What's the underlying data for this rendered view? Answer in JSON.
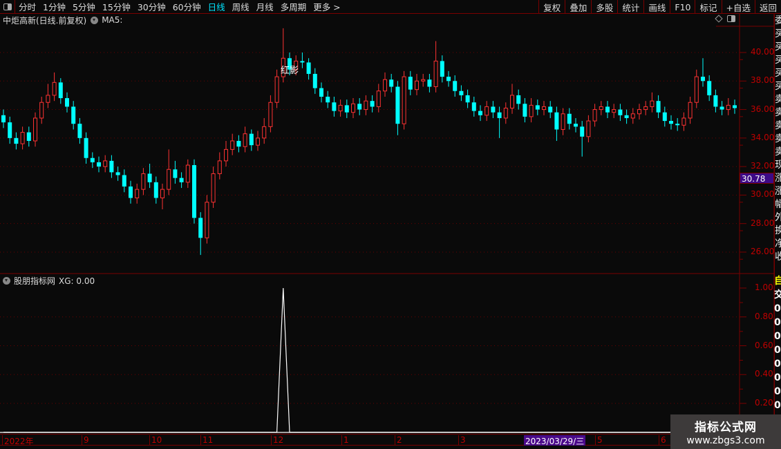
{
  "toolbar": {
    "periods": [
      {
        "label": "分时",
        "active": false
      },
      {
        "label": "1分钟",
        "active": false
      },
      {
        "label": "5分钟",
        "active": false
      },
      {
        "label": "15分钟",
        "active": false
      },
      {
        "label": "30分钟",
        "active": false
      },
      {
        "label": "60分钟",
        "active": false
      },
      {
        "label": "日线",
        "active": true
      },
      {
        "label": "周线",
        "active": false
      },
      {
        "label": "月线",
        "active": false
      },
      {
        "label": "多周期",
        "active": false
      },
      {
        "label": "更多 >",
        "active": false
      }
    ],
    "right_buttons": [
      "复权",
      "叠加",
      "多股",
      "统计",
      "画线",
      "F10",
      "标记",
      "+自选",
      "返回"
    ]
  },
  "main_chart": {
    "title": "中炬高新(日线.前复权)",
    "indicator": "MA5:",
    "annotation": "红影",
    "current_price_tag": "30.78",
    "price_labels": [
      "40.00",
      "38.00",
      "36.00",
      "34.00",
      "32.00",
      "30.00",
      "28.00",
      "26.00"
    ]
  },
  "sub_chart": {
    "title": "股朋指标网",
    "indicator": "XG: 0.00",
    "labels": [
      "1.00",
      "0.80",
      "0.60",
      "0.40",
      "0.20"
    ]
  },
  "time_axis": {
    "labels": [
      "2022年",
      "9",
      "10",
      "11",
      "12",
      "1",
      "2",
      "3",
      "2023/03/29/三",
      "5",
      "6"
    ],
    "highlighted": "2023/03/29/三"
  },
  "side_panel": {
    "chars": [
      "委",
      "买",
      "买",
      "买",
      "买",
      "买",
      "卖",
      "卖",
      "卖",
      "卖",
      "卖",
      "现",
      "涨",
      "涨",
      "幅",
      "外",
      "换",
      "净",
      "收"
    ],
    "sub_chars": [
      "自",
      "交",
      "0",
      "0",
      "0",
      "0",
      "0",
      "0",
      "0",
      "0",
      "0"
    ]
  },
  "watermark": {
    "title": "指标公式网",
    "url": "www.zbgs3.com"
  },
  "colors": {
    "up": "#ff3232",
    "down": "#00ffff",
    "axis": "#c00000",
    "grid": "#7a0000",
    "highlight": "#4b0a8a"
  },
  "chart_data": {
    "type": "candlestick",
    "ylim": [
      25.5,
      42
    ],
    "open": [
      35.6,
      35.1,
      34.0,
      33.6,
      34.4,
      33.8,
      35.4,
      36.5,
      37.0,
      37.9,
      36.8,
      36.2,
      35.0,
      34.0,
      32.6,
      32.3,
      32.0,
      32.4,
      31.6,
      31.4,
      30.6,
      29.8,
      30.4,
      31.5,
      30.9,
      29.8,
      30.4,
      31.8,
      31.2,
      30.9,
      32.1,
      28.4,
      27.0,
      29.5,
      31.5,
      32.4,
      33.2,
      33.8,
      33.4,
      34.3,
      33.5,
      34.0,
      34.8,
      36.5,
      38.3,
      39.6,
      38.8,
      39.4,
      39.3,
      38.5,
      37.5,
      36.9,
      36.5,
      35.9,
      36.3,
      35.8,
      36.4,
      36.0,
      36.6,
      36.2,
      37.3,
      38.1,
      37.6,
      35.0,
      38.3,
      37.4,
      38.0,
      38.1,
      37.6,
      39.4,
      38.3,
      38.0,
      37.3,
      37.0,
      36.5,
      35.9,
      35.6,
      36.2,
      35.8,
      35.4,
      36.1,
      37.0,
      36.4,
      35.5,
      36.3,
      36.0,
      36.2,
      35.8,
      34.6,
      35.7,
      35.0,
      34.8,
      34.1,
      35.2,
      36.0,
      36.2,
      35.8,
      36.0,
      35.6,
      35.4,
      35.7,
      36.0,
      36.2,
      36.6,
      35.8,
      35.2,
      35.0,
      34.9,
      35.4,
      36.5,
      38.3,
      38.0,
      37.0,
      36.2,
      36.0,
      36.3
    ],
    "high": [
      36.0,
      35.5,
      34.4,
      34.8,
      34.8,
      35.8,
      36.9,
      37.8,
      38.6,
      38.2,
      37.2,
      36.6,
      35.4,
      34.4,
      33.0,
      32.7,
      32.8,
      32.8,
      32.0,
      31.8,
      31.0,
      30.8,
      31.9,
      32.2,
      31.3,
      30.8,
      33.2,
      32.4,
      31.6,
      32.5,
      32.5,
      28.8,
      30.0,
      32.0,
      33.0,
      33.8,
      34.3,
      34.2,
      34.8,
      34.6,
      34.5,
      35.4,
      37.0,
      38.8,
      41.7,
      40.0,
      39.8,
      40.0,
      39.6,
      38.9,
      37.9,
      37.3,
      36.9,
      36.7,
      36.7,
      36.8,
      36.8,
      37.0,
      37.0,
      37.8,
      38.6,
      38.5,
      38.0,
      38.7,
      38.7,
      38.5,
      38.5,
      38.5,
      40.8,
      39.8,
      38.7,
      38.4,
      37.7,
      37.4,
      36.9,
      36.3,
      36.6,
      36.6,
      36.2,
      36.5,
      37.8,
      37.4,
      36.8,
      36.8,
      36.7,
      36.6,
      36.6,
      36.2,
      36.1,
      36.1,
      35.4,
      35.2,
      35.6,
      36.4,
      36.6,
      36.6,
      36.4,
      36.4,
      36.0,
      36.1,
      36.4,
      36.6,
      37.2,
      37.0,
      36.2,
      35.6,
      35.4,
      35.8,
      36.9,
      38.8,
      39.6,
      38.4,
      37.4,
      36.6,
      36.8,
      36.7
    ],
    "low": [
      34.7,
      33.6,
      33.2,
      33.2,
      33.4,
      33.4,
      35.0,
      36.1,
      36.6,
      36.4,
      35.8,
      34.6,
      33.6,
      32.2,
      31.9,
      31.6,
      31.6,
      31.2,
      31.0,
      30.2,
      29.4,
      29.4,
      30.0,
      30.5,
      29.4,
      29.0,
      30.0,
      30.8,
      30.5,
      30.5,
      28.0,
      25.8,
      26.6,
      29.1,
      31.1,
      32.0,
      32.8,
      33.0,
      33.0,
      33.1,
      33.1,
      33.6,
      34.4,
      36.1,
      37.9,
      38.4,
      38.4,
      38.9,
      38.1,
      37.1,
      36.5,
      36.1,
      35.5,
      35.5,
      35.4,
      35.4,
      35.6,
      35.6,
      35.8,
      35.8,
      36.9,
      37.2,
      34.2,
      34.6,
      37.0,
      37.0,
      37.6,
      37.2,
      37.2,
      37.9,
      37.6,
      36.9,
      36.6,
      36.1,
      35.5,
      35.2,
      35.2,
      35.4,
      34.0,
      35.0,
      35.7,
      36.0,
      35.1,
      35.1,
      35.6,
      35.6,
      35.4,
      33.8,
      34.2,
      34.6,
      34.4,
      32.7,
      33.7,
      34.8,
      35.6,
      35.4,
      35.4,
      35.2,
      35.0,
      35.0,
      35.3,
      35.6,
      35.8,
      35.4,
      34.8,
      34.6,
      34.5,
      34.5,
      35.0,
      36.1,
      37.6,
      36.6,
      35.8,
      35.6,
      35.6,
      35.7
    ],
    "close": [
      35.1,
      34.0,
      33.6,
      34.4,
      33.8,
      35.4,
      36.5,
      37.0,
      37.9,
      36.8,
      36.2,
      35.0,
      34.0,
      32.6,
      32.3,
      32.0,
      32.4,
      31.6,
      31.4,
      30.6,
      29.8,
      30.4,
      31.5,
      30.9,
      29.8,
      30.4,
      31.8,
      31.2,
      30.9,
      32.1,
      28.4,
      27.0,
      29.5,
      31.5,
      32.4,
      33.2,
      33.8,
      33.4,
      34.3,
      33.5,
      34.0,
      34.8,
      36.5,
      38.3,
      39.6,
      38.8,
      39.4,
      39.3,
      38.5,
      37.5,
      36.9,
      36.5,
      35.9,
      36.3,
      35.8,
      36.4,
      36.0,
      36.6,
      36.2,
      37.3,
      38.1,
      37.6,
      35.0,
      38.3,
      37.4,
      38.0,
      38.1,
      37.6,
      39.4,
      38.3,
      38.0,
      37.3,
      37.0,
      36.5,
      35.9,
      35.6,
      36.2,
      35.8,
      35.4,
      36.1,
      37.0,
      36.4,
      35.5,
      36.3,
      36.0,
      36.2,
      35.8,
      34.6,
      35.7,
      35.0,
      34.8,
      34.1,
      35.2,
      36.0,
      36.2,
      35.8,
      36.0,
      35.6,
      35.4,
      35.7,
      36.0,
      36.2,
      36.6,
      35.8,
      35.2,
      35.0,
      34.9,
      35.4,
      36.5,
      38.3,
      38.0,
      37.0,
      36.2,
      36.0,
      36.3,
      36.1
    ],
    "xg": [
      0,
      0,
      0,
      0,
      0,
      0,
      0,
      0,
      0,
      0,
      0,
      0,
      0,
      0,
      0,
      0,
      0,
      0,
      0,
      0,
      0,
      0,
      0,
      0,
      0,
      0,
      0,
      0,
      0,
      0,
      0,
      0,
      0,
      0,
      0,
      0,
      0,
      0,
      0,
      0,
      0,
      0,
      0,
      0,
      1,
      0,
      0,
      0,
      0,
      0,
      0,
      0,
      0,
      0,
      0,
      0,
      0,
      0,
      0,
      0,
      0,
      0,
      0,
      0,
      0,
      0,
      0,
      0,
      0,
      0,
      0,
      0,
      0,
      0,
      0,
      0,
      0,
      0,
      0,
      0,
      0,
      0,
      0,
      0,
      0,
      0,
      0,
      0,
      0,
      0,
      0,
      0,
      0,
      0,
      0,
      0,
      0,
      0,
      0,
      0,
      0,
      0,
      0,
      0,
      0,
      0,
      0,
      0,
      0,
      0,
      0,
      0,
      0,
      0,
      0,
      0
    ],
    "xg_ylim": [
      0,
      1
    ],
    "grid": true
  }
}
